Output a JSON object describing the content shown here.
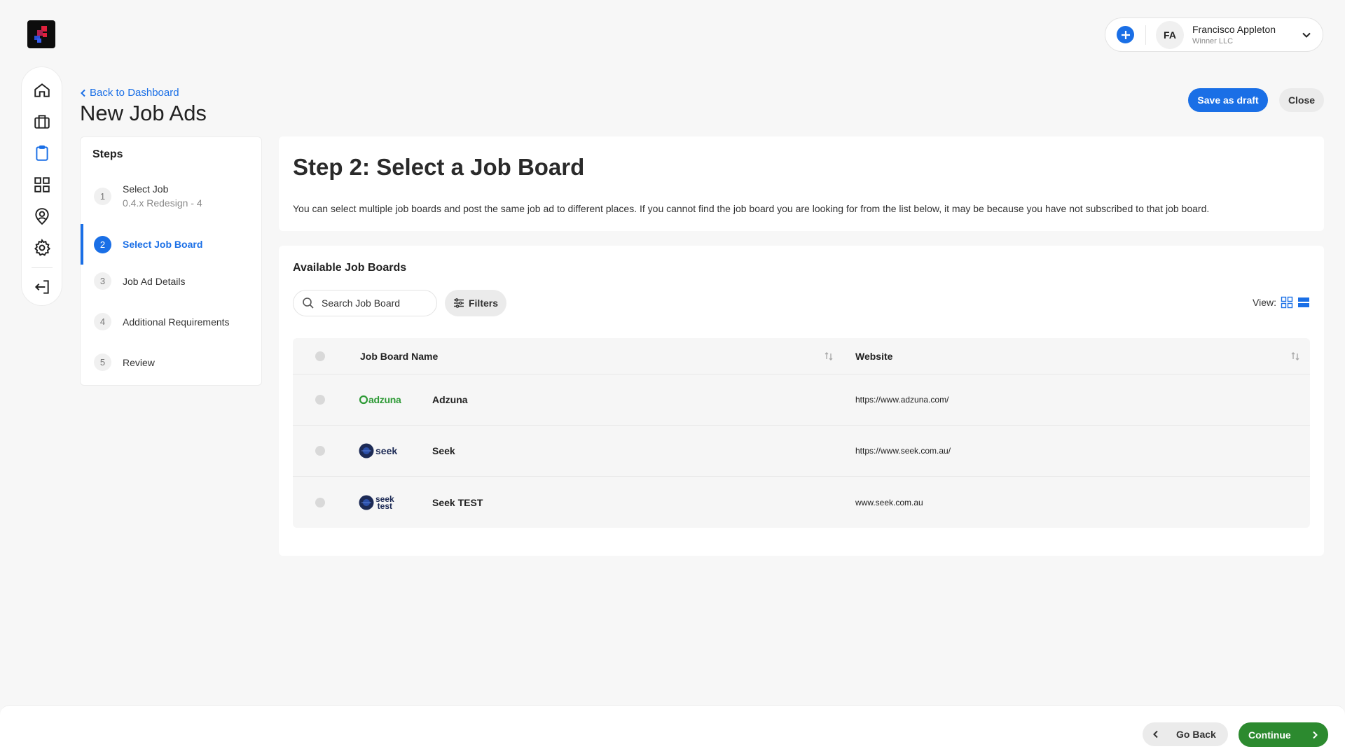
{
  "app": {
    "logo": "brand-logo",
    "accent_color": "#1a6fe6",
    "success_color": "#2c8a2f"
  },
  "sidebar": {
    "items": [
      {
        "name": "home",
        "icon": "home-icon",
        "active": false
      },
      {
        "name": "jobs",
        "icon": "briefcase-icon",
        "active": false
      },
      {
        "name": "job-ads",
        "icon": "clipboard-icon",
        "active": true
      },
      {
        "name": "apps",
        "icon": "grid-icon",
        "active": false
      },
      {
        "name": "profile",
        "icon": "user-badge-icon",
        "active": false
      },
      {
        "name": "settings",
        "icon": "gear-icon",
        "active": false
      },
      {
        "name": "logout",
        "icon": "logout-icon",
        "active": false
      }
    ]
  },
  "user": {
    "initials": "FA",
    "name": "Francisco Appleton",
    "company": "Winner LLC"
  },
  "header": {
    "back_label": "Back to Dashboard",
    "title": "New Job Ads",
    "save_draft_label": "Save as draft",
    "close_label": "Close"
  },
  "steps": {
    "title": "Steps",
    "items": [
      {
        "num": "1",
        "label": "Select Job",
        "sub": "0.4.x Redesign - 4"
      },
      {
        "num": "2",
        "label": "Select Job Board",
        "sub": ""
      },
      {
        "num": "3",
        "label": "Job Ad Details",
        "sub": ""
      },
      {
        "num": "4",
        "label": "Additional Requirements",
        "sub": ""
      },
      {
        "num": "5",
        "label": "Review",
        "sub": ""
      }
    ],
    "active_index": 1
  },
  "intro": {
    "title": "Step 2: Select a Job Board",
    "description": "You can select multiple job boards and post the same job ad to different places. If you cannot find the job board you are looking for from the list below, it may be because you have not subscribed to that job board."
  },
  "boards": {
    "title": "Available Job Boards",
    "search_placeholder": "Search Job Board",
    "filters_label": "Filters",
    "view_label": "View:",
    "columns": {
      "name": "Job Board Name",
      "website": "Website"
    },
    "rows": [
      {
        "logo": "adzuna-logo",
        "logo_text": "adzuna",
        "name": "Adzuna",
        "website": "https://www.adzuna.com/"
      },
      {
        "logo": "seek-logo",
        "logo_text": "seek",
        "name": "Seek",
        "website": "https://www.seek.com.au/"
      },
      {
        "logo": "seek-test-logo",
        "logo_text": "seek test",
        "name": "Seek TEST",
        "website": "www.seek.com.au"
      }
    ]
  },
  "footer": {
    "go_back_label": "Go Back",
    "continue_label": "Continue"
  }
}
